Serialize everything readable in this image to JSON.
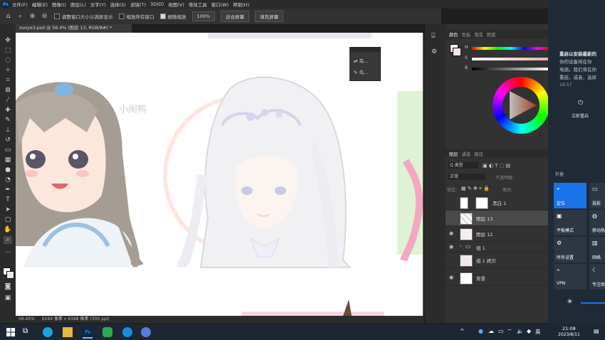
{
  "menu": {
    "app_icon": "Ps",
    "items": [
      "文件(F)",
      "编辑(E)",
      "图像(I)",
      "图层(L)",
      "文字(Y)",
      "选择(S)",
      "滤镜(T)",
      "3D(D)",
      "视图(V)",
      "增效工具",
      "窗口(W)",
      "帮助(H)"
    ]
  },
  "options": {
    "resize_windows": "调整窗口大小以满屏显示",
    "zoom_all": "缩放所有窗口",
    "scrubby_zoom": "细微缩放",
    "zoom_level": "100%",
    "fit_screen": "适合屏幕",
    "fill_screen": "填充屏幕"
  },
  "document": {
    "tab_title": "zuoye3.psd @ 56.4% (图层 13, RGB/8#) *",
    "watermark_text": "小闹鸭",
    "status_zoom": "56.45%",
    "status_info": "6164 像素 x 6348 像素 (300 ppi)"
  },
  "mini_panel": {
    "row1": "鸟...",
    "row2": "鸟..."
  },
  "panels": {
    "color_tabs": [
      "颜色",
      "色板",
      "渐变",
      "图案"
    ],
    "slider_labels": [
      "H",
      "S",
      "B"
    ],
    "layer_tabs": [
      "图层",
      "通道",
      "路径"
    ],
    "kind_filter": "Q 类型",
    "blend_mode": "正常",
    "opacity_label": "不透明度:",
    "lock_label": "锁定:",
    "fill_label": "填充:",
    "layers": [
      {
        "name": "黑白 1",
        "visible": false
      },
      {
        "name": "图层 13",
        "visible": false
      },
      {
        "name": "图层 12",
        "visible": true
      },
      {
        "name": "组 1",
        "visible": true
      },
      {
        "name": "组 1 拷贝",
        "visible": false
      },
      {
        "name": "背景",
        "visible": true
      }
    ]
  },
  "notification": {
    "title": "重启以安装最新的",
    "body1": "你的设备将在你",
    "body2": "电源。我们将在你",
    "body3": "重启，或者，选择",
    "time": "19:57",
    "restart_label": "立即重启",
    "collapse_label": "折叠",
    "quick_actions": [
      {
        "label": "定位",
        "icon": "location-icon",
        "active": true
      },
      {
        "label": "投影",
        "icon": "project-icon",
        "active": false
      },
      {
        "label": "平板模式",
        "icon": "tablet-icon",
        "active": false
      },
      {
        "label": "移动热",
        "icon": "hotspot-icon",
        "active": false
      },
      {
        "label": "所有设置",
        "icon": "settings-icon",
        "active": false
      },
      {
        "label": "网络",
        "icon": "network-icon",
        "active": false
      },
      {
        "label": "VPN",
        "icon": "vpn-icon",
        "active": false
      },
      {
        "label": "专注助",
        "icon": "focus-icon",
        "active": false
      }
    ]
  },
  "taskbar": {
    "time": "21:08",
    "date": "2023/8/11",
    "ime": "英"
  },
  "colors": {
    "accent": "#1a73e8",
    "ps_blue": "#31a8ff"
  }
}
